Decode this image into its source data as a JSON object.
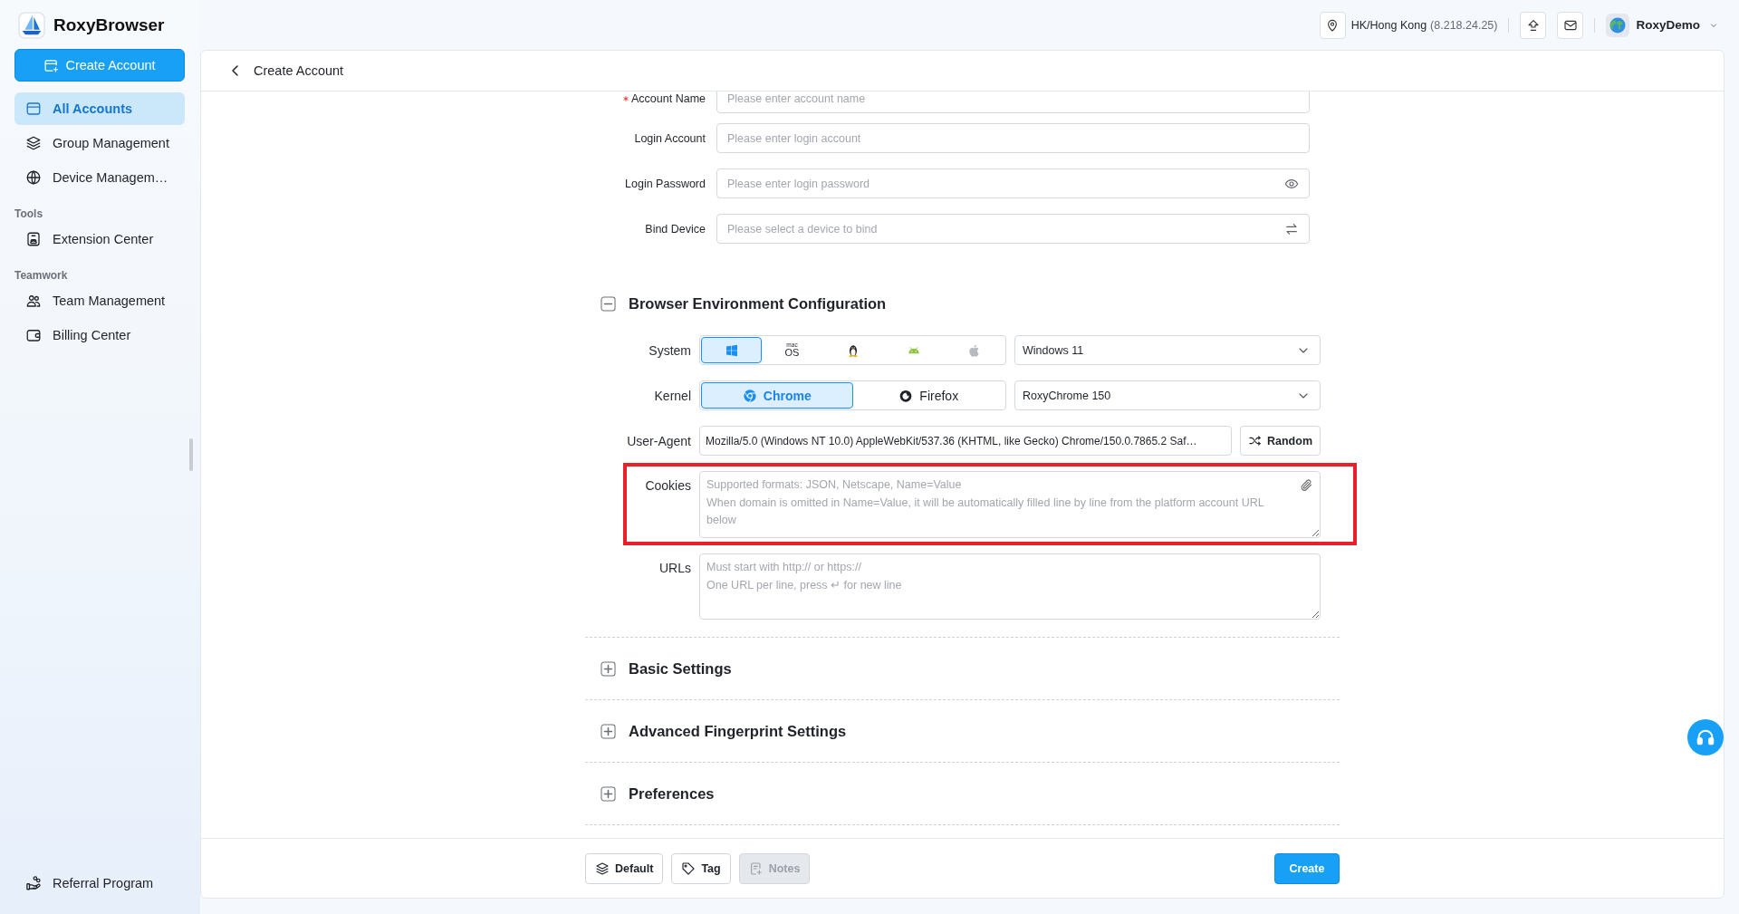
{
  "app": {
    "name": "RoxyBrowser"
  },
  "sidebar": {
    "create_button": "Create Account",
    "groups": [
      {
        "items": [
          {
            "kind": "accounts",
            "label": "All Accounts",
            "selected": true
          },
          {
            "kind": "groups",
            "label": "Group Management",
            "selected": false
          },
          {
            "kind": "devices",
            "label": "Device Managem…",
            "selected": false
          }
        ]
      },
      {
        "title": "Tools",
        "items": [
          {
            "kind": "extensions",
            "label": "Extension Center",
            "selected": false
          }
        ]
      },
      {
        "title": "Teamwork",
        "items": [
          {
            "kind": "team",
            "label": "Team Management",
            "selected": false
          },
          {
            "kind": "billing",
            "label": "Billing Center",
            "selected": false
          }
        ]
      }
    ],
    "bottom_items": [
      {
        "kind": "referral",
        "label": "Referral Program",
        "selected": false
      }
    ]
  },
  "top_bar": {
    "location": "HK/Hong Kong",
    "ip": "(8.218.24.25)",
    "user": "RoxyDemo"
  },
  "page": {
    "title": "Create Account"
  },
  "fields": [
    {
      "kind": "text",
      "label": "Account Name",
      "required": true,
      "placeholder": "Please enter account name"
    },
    {
      "kind": "text",
      "label": "Login Account",
      "required": false,
      "placeholder": "Please enter login account"
    },
    {
      "kind": "password",
      "label": "Login Password",
      "required": false,
      "placeholder": "Please enter login password"
    },
    {
      "kind": "device",
      "label": "Bind Device",
      "required": false,
      "placeholder": "Please select a device to bind"
    }
  ],
  "sections": [
    {
      "title": "Browser Environment Configuration",
      "expanded": true,
      "rows": [
        {
          "kind": "system",
          "label": "System",
          "options": [
            {
              "kind": "windows",
              "selected": true
            },
            {
              "kind": "macos",
              "lines": [
                "mac",
                "OS"
              ],
              "selected": false
            },
            {
              "kind": "linux",
              "selected": false
            },
            {
              "kind": "android",
              "selected": false
            },
            {
              "kind": "apple",
              "selected": false
            }
          ],
          "select": "Windows 11"
        },
        {
          "kind": "kernel",
          "label": "Kernel",
          "options": [
            {
              "kind": "chrome",
              "label": "Chrome",
              "selected": true
            },
            {
              "kind": "firefox",
              "label": "Firefox",
              "selected": false
            }
          ],
          "select": "RoxyChrome 150"
        },
        {
          "kind": "user_agent",
          "label": "User-Agent",
          "value": "Mozilla/5.0 (Windows NT 10.0) AppleWebKit/537.36 (KHTML, like Gecko) Chrome/150.0.7865.2 Saf…",
          "button": "Random"
        },
        {
          "kind": "cookies",
          "label": "Cookies",
          "placeholder": "Supported formats: JSON, Netscape, Name=Value\nWhen domain is omitted in Name=Value, it will be automatically filled line by line from the platform account URL below",
          "highlighted": true
        },
        {
          "kind": "urls",
          "label": "URLs",
          "placeholder": "Must start with http:// or https://\nOne URL per line, press ↵ for new line",
          "highlighted": false
        }
      ]
    },
    {
      "title": "Basic Settings",
      "expanded": false
    },
    {
      "title": "Advanced Fingerprint Settings",
      "expanded": false
    },
    {
      "title": "Preferences",
      "expanded": false
    }
  ],
  "footer": {
    "buttons": [
      {
        "kind": "default",
        "label": "Default",
        "disabled": false
      },
      {
        "kind": "tag",
        "label": "Tag",
        "disabled": false
      },
      {
        "kind": "notes",
        "label": "Notes",
        "disabled": true
      }
    ],
    "submit": "Create"
  }
}
